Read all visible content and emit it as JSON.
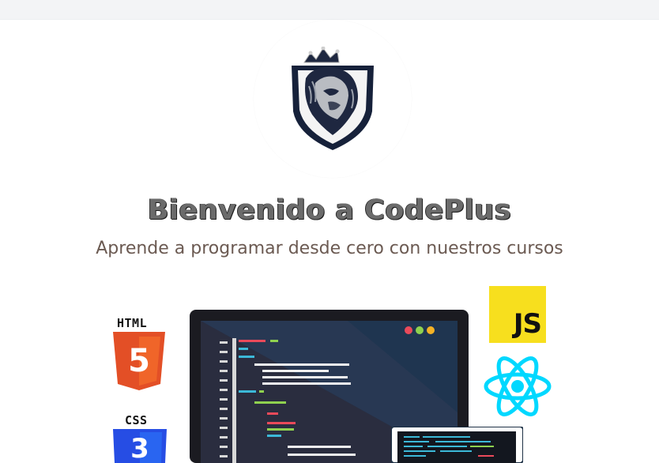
{
  "header": {
    "title": "Bienvenido a CodePlus",
    "subtitle": "Aprende a programar desde cero con nuestros cursos"
  },
  "logo": {
    "icon": "lion-crest-icon"
  },
  "hero": {
    "html_label": "HTML",
    "html_number": "5",
    "css_label": "CSS",
    "css_number": "3",
    "js_label": "JS"
  },
  "colors": {
    "html": "#e34f26",
    "css": "#264de4",
    "js": "#f7df1e",
    "react": "#00d8ff",
    "monitor": "#1b1b21"
  }
}
